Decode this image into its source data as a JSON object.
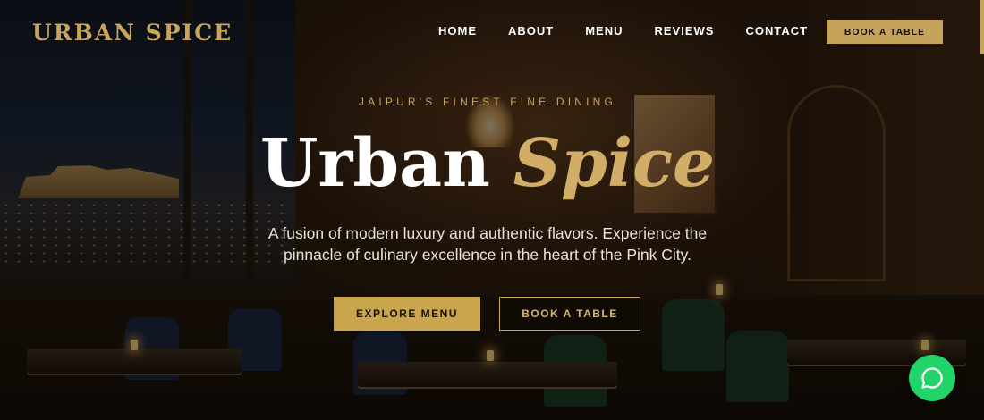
{
  "brand": {
    "logo": "URBAN SPICE"
  },
  "nav": {
    "items": [
      {
        "label": "HOME"
      },
      {
        "label": "ABOUT"
      },
      {
        "label": "MENU"
      },
      {
        "label": "REVIEWS"
      },
      {
        "label": "CONTACT"
      }
    ],
    "cta_label": "BOOK A TABLE"
  },
  "hero": {
    "eyebrow": "JAIPUR'S FINEST FINE DINING",
    "title_main": "Urban",
    "title_accent": "Spice",
    "subtitle": "A fusion of modern luxury and authentic flavors. Experience the pinnacle of culinary excellence in the heart of the Pink City.",
    "primary_button": "EXPLORE MENU",
    "secondary_button": "BOOK A TABLE"
  },
  "floating": {
    "icon": "whatsapp-chat-icon"
  },
  "colors": {
    "gold": "#c9a54e",
    "gold_text": "#d2ad68",
    "whatsapp_green": "#22d36a",
    "dark": "#0d0a08"
  }
}
